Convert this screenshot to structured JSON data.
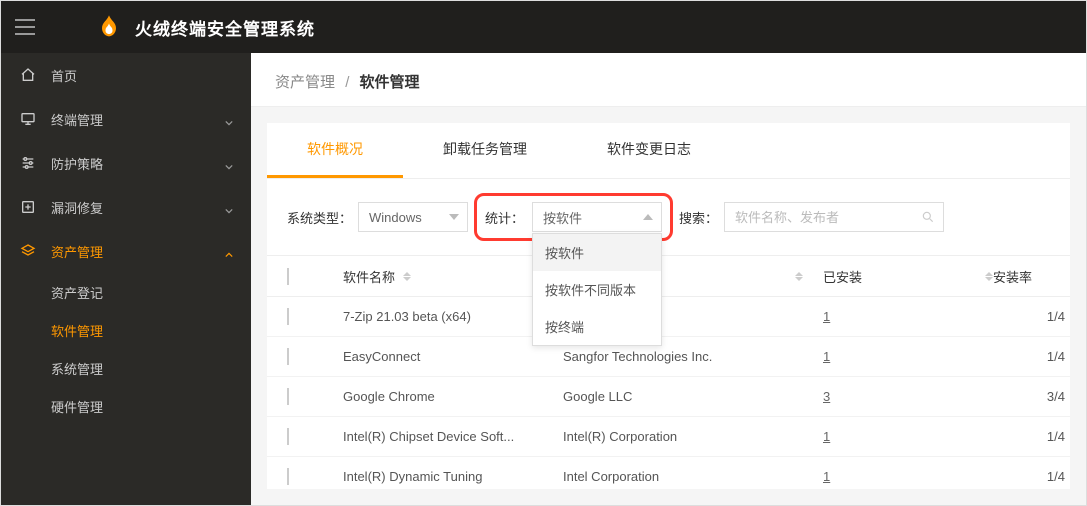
{
  "app_title": "火绒终端安全管理系统",
  "sidebar": {
    "items": [
      {
        "icon": "home",
        "label": "首页",
        "expandable": false
      },
      {
        "icon": "monitor",
        "label": "终端管理",
        "expandable": true
      },
      {
        "icon": "sliders",
        "label": "防护策略",
        "expandable": true
      },
      {
        "icon": "plus-box",
        "label": "漏洞修复",
        "expandable": true
      },
      {
        "icon": "layers",
        "label": "资产管理",
        "expandable": true,
        "active": true,
        "children": [
          {
            "label": "资产登记"
          },
          {
            "label": "软件管理",
            "active": true
          },
          {
            "label": "系统管理"
          },
          {
            "label": "硬件管理"
          }
        ]
      }
    ]
  },
  "breadcrumb": {
    "parent": "资产管理",
    "current": "软件管理"
  },
  "tabs": [
    {
      "label": "软件概况",
      "active": true
    },
    {
      "label": "卸载任务管理"
    },
    {
      "label": "软件变更日志"
    }
  ],
  "filters": {
    "system_label": "系统类型：",
    "system_value": "Windows",
    "stat_label": "统计：",
    "stat_value": "按软件",
    "stat_options": [
      "按软件",
      "按软件不同版本",
      "按终端"
    ],
    "search_label": "搜索：",
    "search_placeholder": "软件名称、发布者"
  },
  "table": {
    "columns": {
      "name": "软件名称",
      "installed": "已安装",
      "rate": "安装率"
    },
    "rows": [
      {
        "name": "7-Zip 21.03 beta (x64)",
        "publisher": "",
        "installed": "1",
        "rate": "1/4"
      },
      {
        "name": "EasyConnect",
        "publisher": "Sangfor Technologies Inc.",
        "installed": "1",
        "rate": "1/4"
      },
      {
        "name": "Google Chrome",
        "publisher": "Google LLC",
        "installed": "3",
        "rate": "3/4"
      },
      {
        "name": "Intel(R) Chipset Device Soft...",
        "publisher": "Intel(R) Corporation",
        "installed": "1",
        "rate": "1/4"
      },
      {
        "name": "Intel(R) Dynamic Tuning",
        "publisher": "Intel Corporation",
        "installed": "1",
        "rate": "1/4"
      }
    ]
  }
}
